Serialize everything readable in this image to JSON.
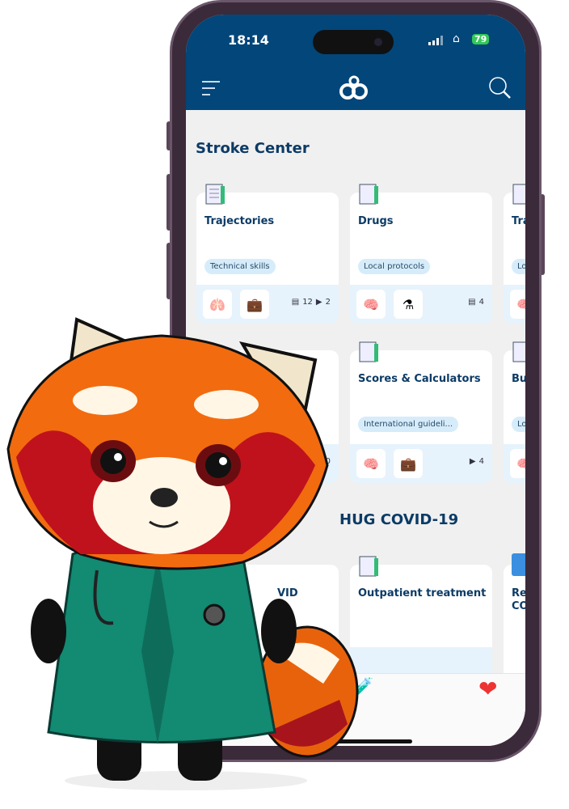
{
  "status": {
    "time": "18:14",
    "battery": "79"
  },
  "header": {
    "menu_icon": "menu-icon",
    "logo_icon": "app-logo",
    "search_icon": "search-icon",
    "brand_color": "#02467a"
  },
  "sections": [
    {
      "title": "Stroke Center",
      "cards": [
        {
          "title": "Trajectories",
          "tag": "Technical skills",
          "docs": "12",
          "videos": "2"
        },
        {
          "title": "Drugs",
          "tag": "Local protocols",
          "docs": "4",
          "videos": ""
        },
        {
          "title": "Tra",
          "tag": "Lo"
        },
        {
          "title": "",
          "tag": "",
          "docs": "",
          "videos": "20"
        },
        {
          "title": "Scores & Calculators",
          "tag": "International guideli...",
          "docs": "",
          "videos": "4"
        },
        {
          "title": "Bu",
          "tag": "Lo"
        }
      ]
    },
    {
      "title": "HUG COVID-19",
      "cards": [
        {
          "title": "VID"
        },
        {
          "title": "Outpatient treatment"
        },
        {
          "title": "Re CO"
        }
      ]
    }
  ],
  "bottom_nav": [
    {
      "icon": "notes-icon"
    },
    {
      "icon": "medicine-icon"
    },
    {
      "icon": "heart-icon"
    }
  ]
}
